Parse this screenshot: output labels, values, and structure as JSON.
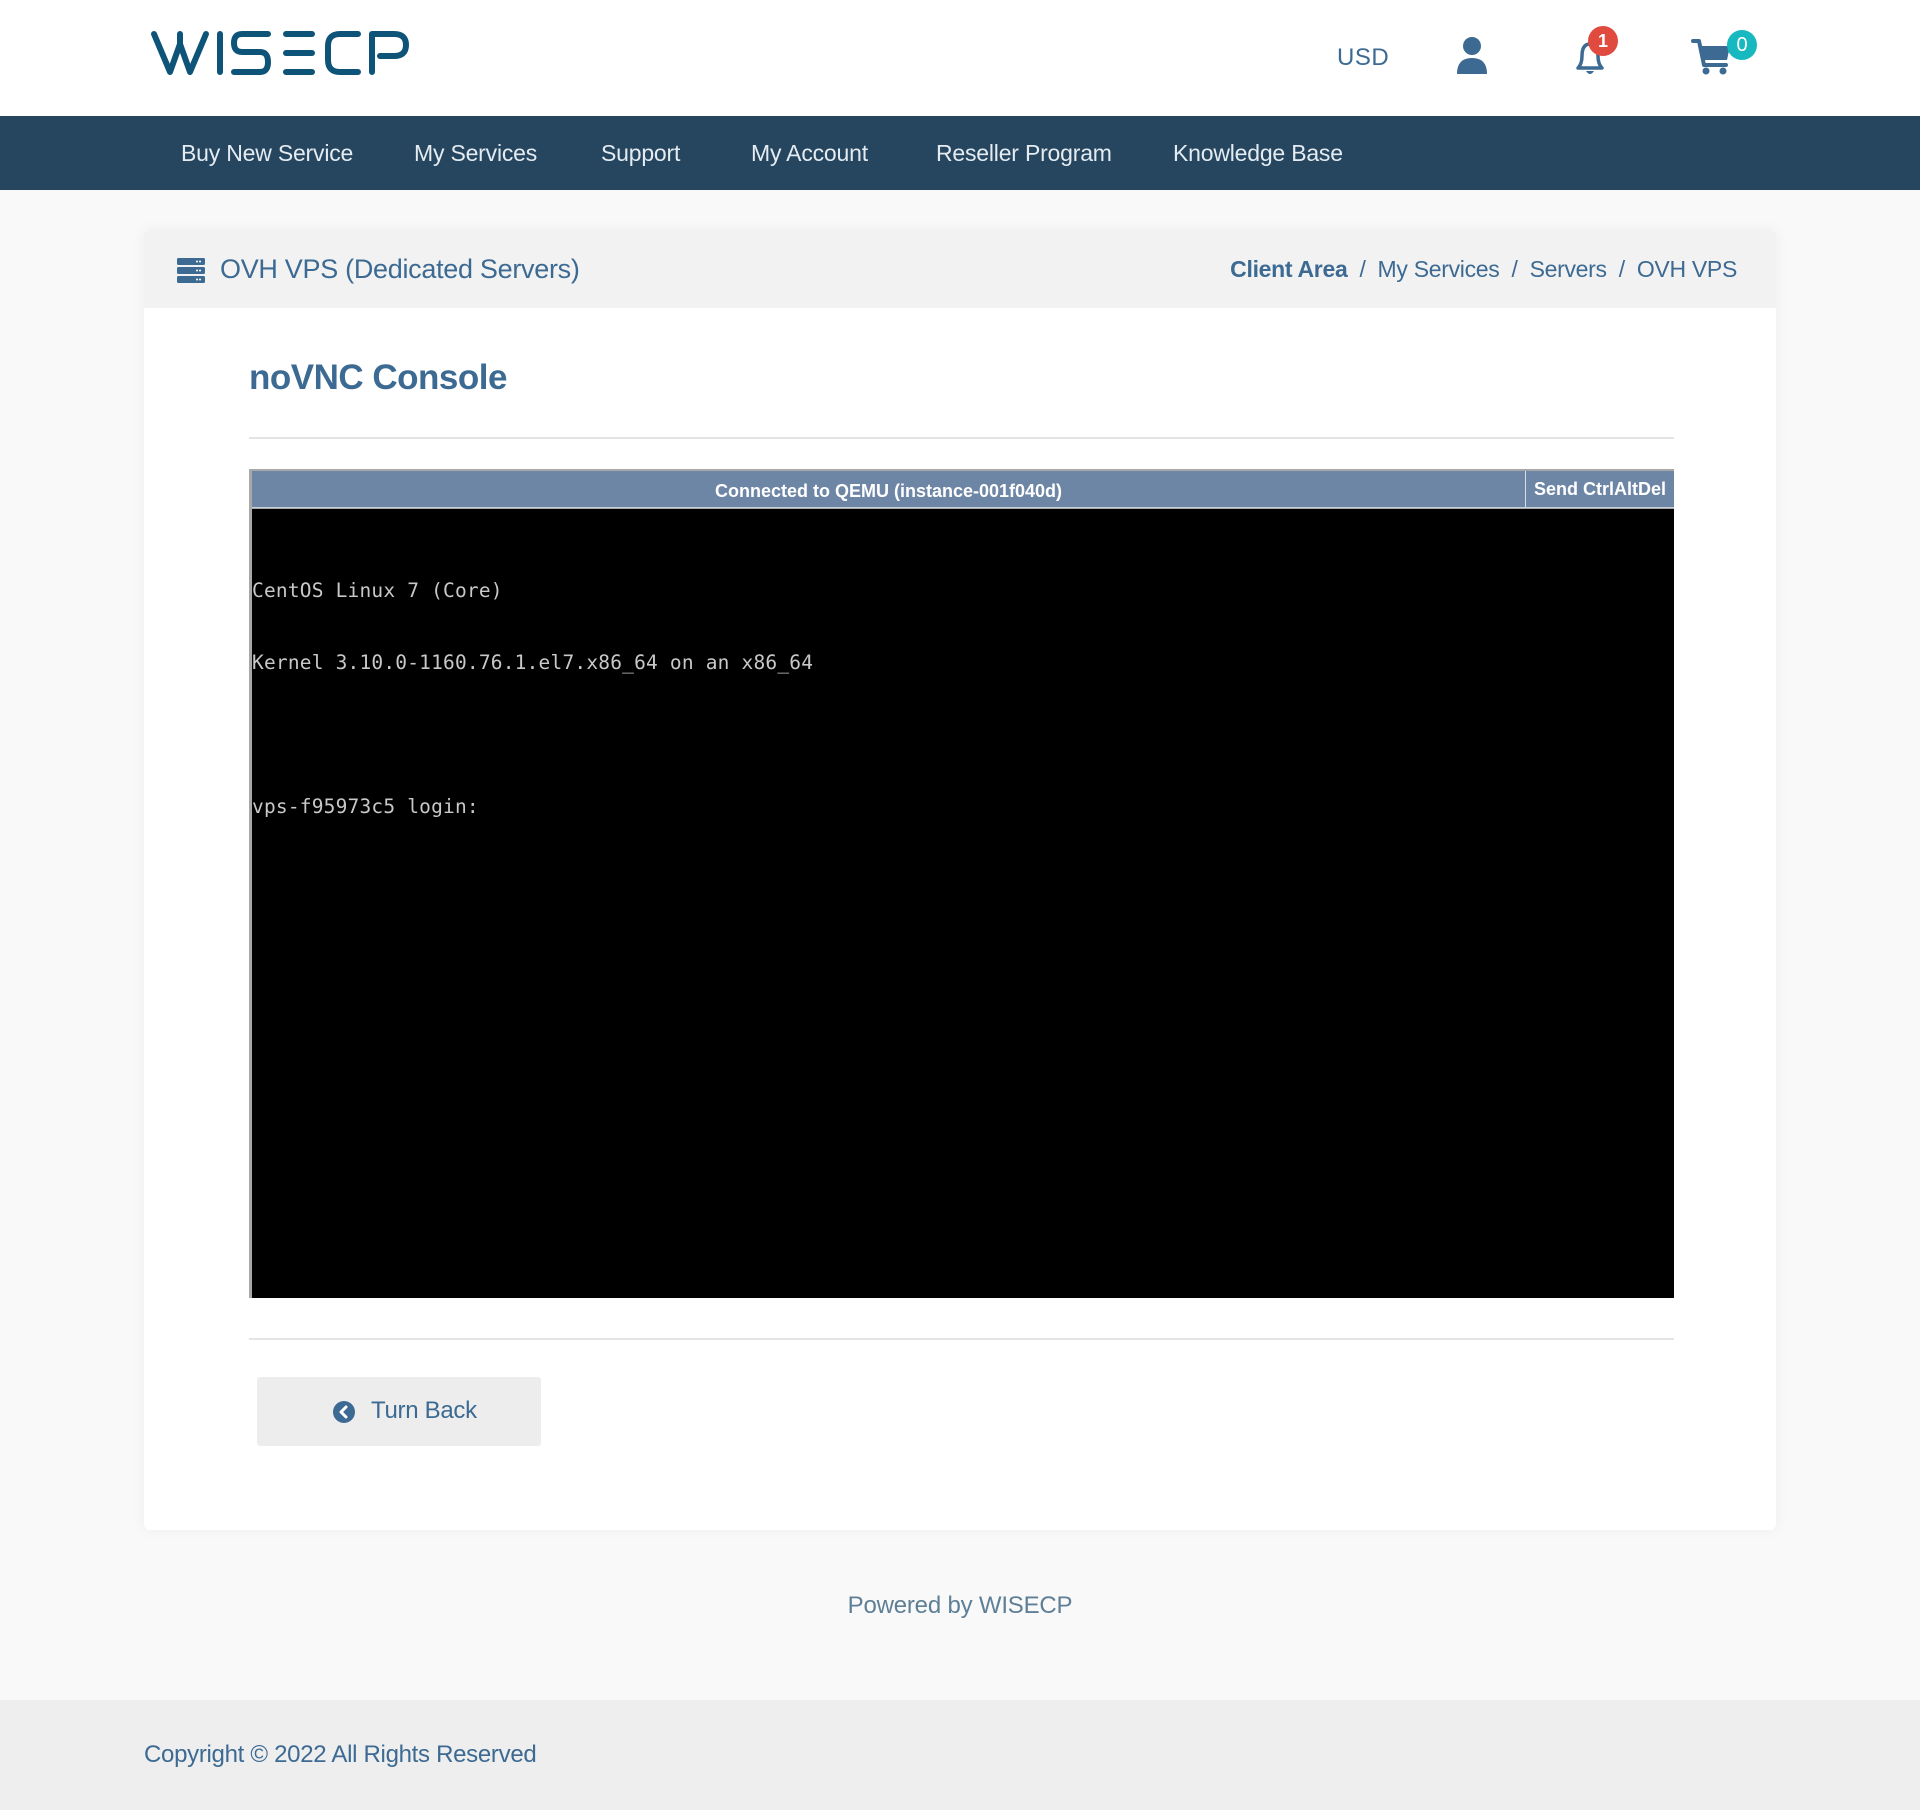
{
  "brand": {
    "name": "WISECP",
    "color": "#0e5478"
  },
  "header": {
    "currency": "USD",
    "icons": [
      "user-icon",
      "bell-icon",
      "cart-icon"
    ],
    "notifications_count": "1",
    "cart_count": "0"
  },
  "nav": {
    "items": [
      {
        "label": "Buy New Service"
      },
      {
        "label": "My Services"
      },
      {
        "label": "Support"
      },
      {
        "label": "My Account"
      },
      {
        "label": "Reseller Program"
      },
      {
        "label": "Knowledge Base"
      }
    ]
  },
  "page": {
    "title": "OVH VPS (Dedicated Servers)",
    "icon": "server-icon",
    "breadcrumb": [
      "Client Area",
      "My Services",
      "Servers",
      "OVH VPS"
    ],
    "breadcrumb_separator": "/",
    "section_title": "noVNC Console"
  },
  "console": {
    "status": "Connected to QEMU (instance-001f040d)",
    "send_cad_label": "Send CtrlAltDel",
    "lines": [
      "CentOS Linux 7 (Core)",
      "Kernel 3.10.0-1160.76.1.el7.x86_64 on an x86_64",
      "",
      "vps-f95973c5 login:"
    ],
    "bar_color": "#6e86a5"
  },
  "actions": {
    "back_label": "Turn Back",
    "back_icon": "chevron-circle-left-icon"
  },
  "footer": {
    "powered_by": "Powered by WISECP",
    "copyright": "Copyright © 2022 All Rights Reserved"
  },
  "colors": {
    "primary_text": "#3c6a92",
    "navbar": "#26455e",
    "badge_notify": "#e04a3f",
    "badge_cart": "#17b8bf"
  }
}
